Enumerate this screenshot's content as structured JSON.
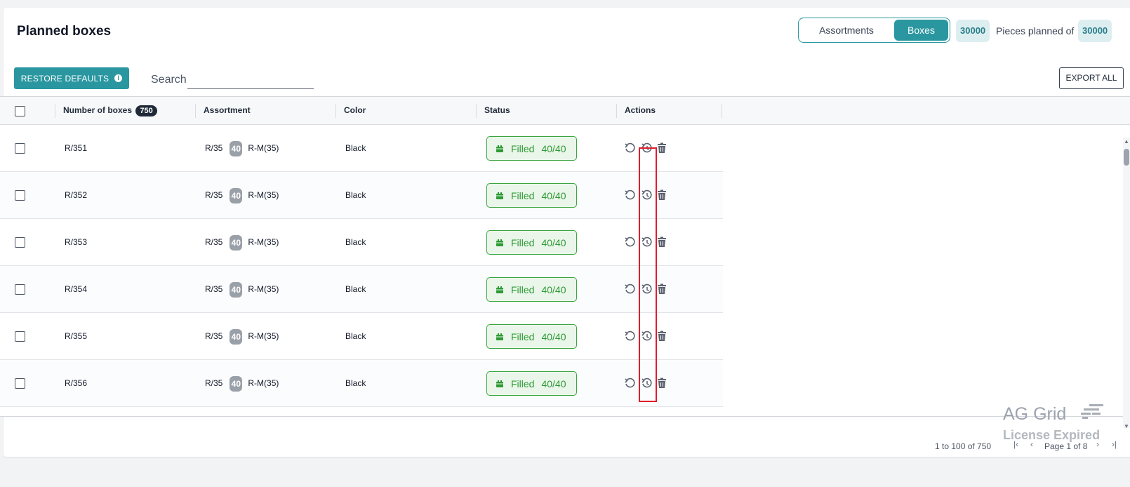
{
  "header": {
    "title": "Planned boxes",
    "toggle": {
      "options": [
        "Assortments",
        "Boxes"
      ],
      "active": "Boxes"
    },
    "planned_count": "30000",
    "pieces_text": "Pieces planned of",
    "total_count": "30000"
  },
  "toolbar": {
    "restore_label": "RESTORE DEFAULTS",
    "search_label": "Search",
    "search_value": "",
    "export_label": "EXPORT ALL"
  },
  "grid": {
    "columns": [
      "Number of boxes",
      "Assortment",
      "Color",
      "Status",
      "Actions"
    ],
    "box_count": "750",
    "rows": [
      {
        "number": "R/351",
        "asst_size": "R/35",
        "asst_qty": "40",
        "asst_range": "R-M(35)",
        "color": "Black",
        "status": "Filled",
        "fill": "40/40"
      },
      {
        "number": "R/352",
        "asst_size": "R/35",
        "asst_qty": "40",
        "asst_range": "R-M(35)",
        "color": "Black",
        "status": "Filled",
        "fill": "40/40"
      },
      {
        "number": "R/353",
        "asst_size": "R/35",
        "asst_qty": "40",
        "asst_range": "R-M(35)",
        "color": "Black",
        "status": "Filled",
        "fill": "40/40"
      },
      {
        "number": "R/354",
        "asst_size": "R/35",
        "asst_qty": "40",
        "asst_range": "R-M(35)",
        "color": "Black",
        "status": "Filled",
        "fill": "40/40"
      },
      {
        "number": "R/355",
        "asst_size": "R/35",
        "asst_qty": "40",
        "asst_range": "R-M(35)",
        "color": "Black",
        "status": "Filled",
        "fill": "40/40"
      },
      {
        "number": "R/356",
        "asst_size": "R/35",
        "asst_qty": "40",
        "asst_range": "R-M(35)",
        "color": "Black",
        "status": "Filled",
        "fill": "40/40"
      }
    ]
  },
  "footer": {
    "range_text": "1 to 100 of 750",
    "page_text": "Page 1 of 8"
  },
  "watermark": {
    "line1": "AG Grid",
    "line2": "License Expired"
  },
  "colors": {
    "accent": "#2a97a0",
    "status_green": "#2e9a35",
    "highlight_red": "#e11d2a"
  },
  "icons": [
    "info-icon",
    "undo-icon",
    "history-icon",
    "trash-icon",
    "box-icon",
    "first-page-icon",
    "prev-page-icon",
    "next-page-icon",
    "last-page-icon"
  ]
}
